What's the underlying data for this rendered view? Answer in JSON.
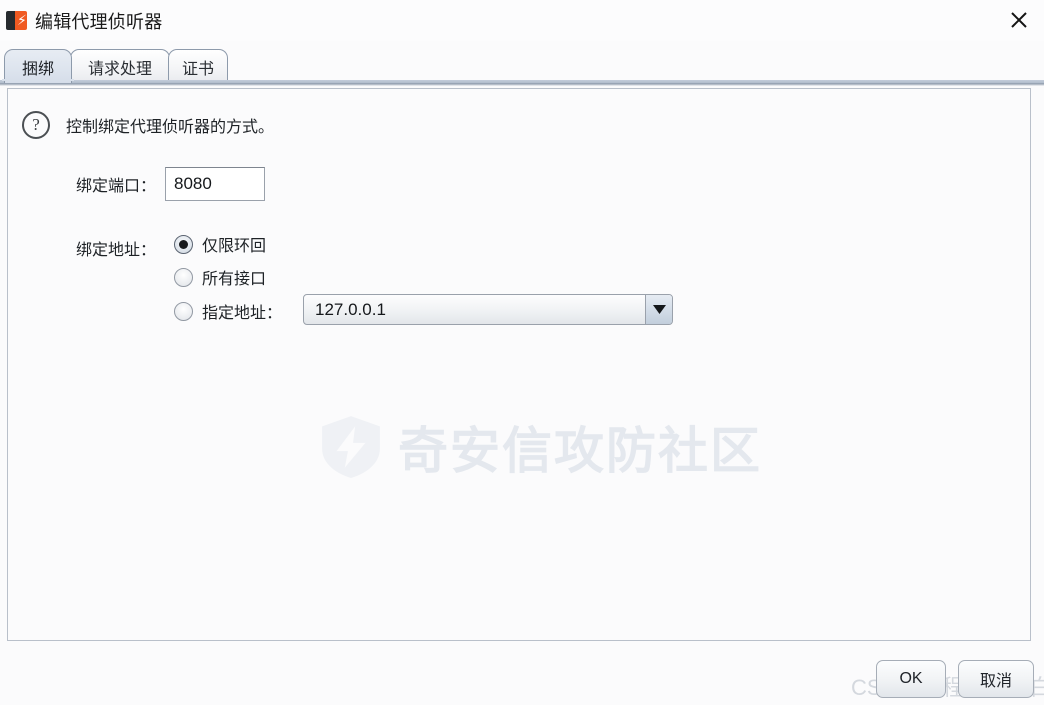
{
  "window": {
    "title": "编辑代理侦听器",
    "icon": "burp-suite-icon",
    "close_icon": "close-icon"
  },
  "tabs": [
    {
      "label": "捆绑",
      "active": true
    },
    {
      "label": "请求处理",
      "active": false
    },
    {
      "label": "证书",
      "active": false
    }
  ],
  "content": {
    "help_icon": "question-mark-icon",
    "help_text": "控制绑定代理侦听器的方式。",
    "port": {
      "label": "绑定端口：",
      "value": "8080",
      "placeholder": ""
    },
    "bind_address": {
      "label": "绑定地址：",
      "options": [
        {
          "label": "仅限环回",
          "selected": true
        },
        {
          "label": "所有接口",
          "selected": false
        },
        {
          "label": "指定地址：",
          "selected": false
        }
      ],
      "specific_address_select": {
        "value": "127.0.0.1",
        "arrow_icon": "chevron-down-icon"
      }
    }
  },
  "footer": {
    "ok_label": "OK",
    "cancel_label": "取消"
  },
  "watermarks": {
    "center_text": "奇安信攻防社区",
    "center_logo": "shield-bolt-icon",
    "corner_text": "CSDN @程序员小白"
  },
  "colors": {
    "brand_orange": "#f05a22",
    "brand_dark": "#272b2f",
    "panel_border": "#b9c0ca",
    "tab_border": "#8d9aab",
    "background": "#fbfbfc"
  }
}
